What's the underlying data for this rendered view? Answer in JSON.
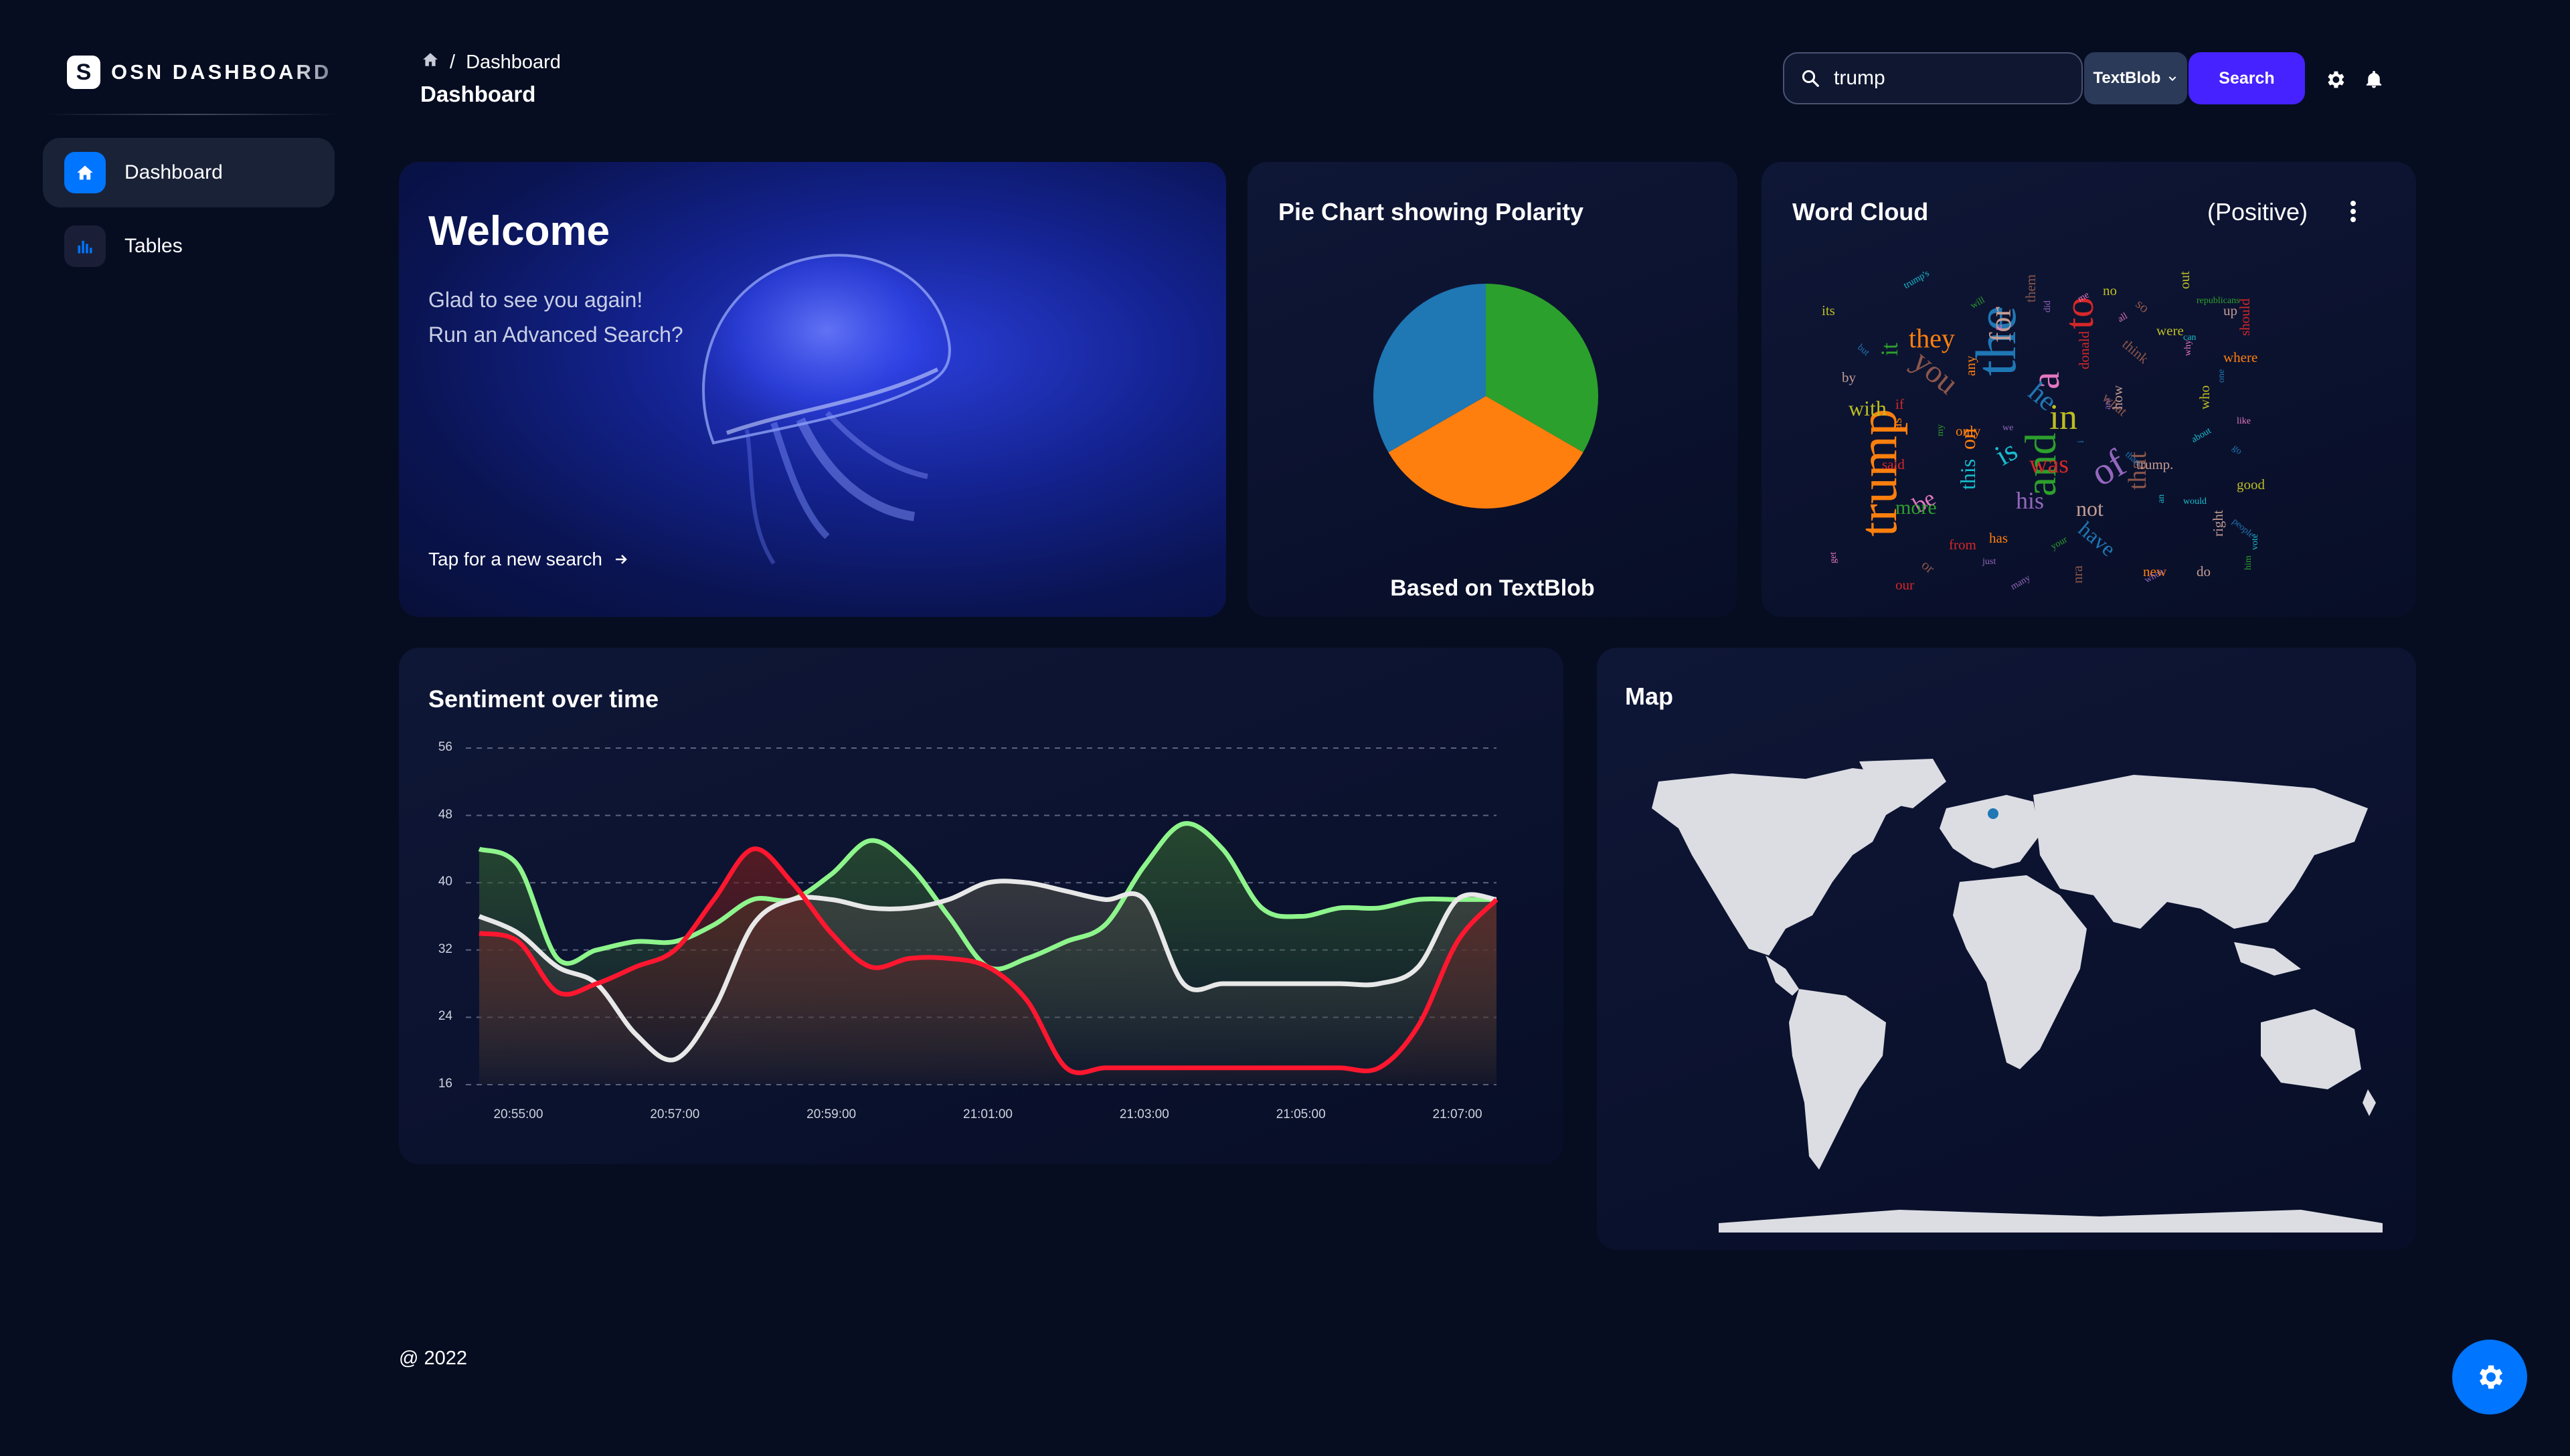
{
  "app": {
    "logo_mark": "S",
    "title": "OSN DASHBOARD"
  },
  "sidebar": {
    "items": [
      {
        "label": "Dashboard",
        "icon": "home-icon",
        "active": true
      },
      {
        "label": "Tables",
        "icon": "bar-chart-icon",
        "active": false
      }
    ]
  },
  "header": {
    "breadcrumb_current": "Dashboard",
    "title": "Dashboard",
    "search_value": "trump",
    "engine": "TextBlob",
    "search_label": "Search"
  },
  "welcome": {
    "title": "Welcome",
    "line1": "Glad to see you again!",
    "line2": "Run an Advanced Search?",
    "link": "Tap for a new search"
  },
  "pie": {
    "title": "Pie Chart showing Polarity",
    "caption": "Based on TextBlob"
  },
  "word_cloud": {
    "title": "Word Cloud",
    "subtitle": "(Positive)",
    "words": [
      "the",
      "trump",
      "and",
      "to",
      "of",
      "you",
      "a",
      "in",
      "is",
      "for",
      "he",
      "they",
      "it",
      "was",
      "his",
      "that",
      "be",
      "with",
      "this",
      "not",
      "have",
      "on",
      "more",
      "from",
      "are",
      "what",
      "at",
      "who",
      "about",
      "trump.",
      "i",
      "has",
      "your",
      "donald",
      "just",
      "think",
      "why",
      "were",
      "would",
      "right",
      "people",
      "new",
      "him",
      "our",
      "many",
      "nra",
      "like",
      "good",
      "vote",
      "by",
      "but",
      "as",
      "will",
      "if",
      "did",
      "so",
      "all",
      "out",
      "can",
      "up",
      "one",
      "where",
      "republicans",
      "should",
      "when",
      "or",
      "get",
      "its",
      "trump's",
      "how",
      "than",
      "only",
      "my",
      "said",
      "we",
      "them",
      "me",
      "no",
      "an",
      "do",
      "go",
      "any"
    ]
  },
  "trend": {
    "title": "Sentiment over time",
    "chart_data": {
      "type": "area",
      "x": [
        "20:54:30",
        "20:55:00",
        "20:55:30",
        "20:56:00",
        "20:56:30",
        "20:57:00",
        "20:57:30",
        "20:58:00",
        "20:58:30",
        "20:59:00",
        "20:59:30",
        "21:00:00",
        "21:00:30",
        "21:01:00",
        "21:01:30",
        "21:02:00",
        "21:02:30",
        "21:03:00",
        "21:03:30",
        "21:04:00",
        "21:04:30",
        "21:05:00",
        "21:05:30",
        "21:06:00",
        "21:06:30",
        "21:07:00",
        "21:07:30"
      ],
      "x_ticks": [
        "20:55:00",
        "20:57:00",
        "20:59:00",
        "21:01:00",
        "21:03:00",
        "21:05:00",
        "21:07:00"
      ],
      "ylim": [
        16,
        56
      ],
      "y_ticks": [
        16,
        24,
        32,
        40,
        48,
        56
      ],
      "series": [
        {
          "color": "#8ef58c",
          "fill_top": "#2f5a2f",
          "values": [
            44,
            42,
            31,
            32,
            33,
            33,
            35,
            38,
            38,
            41,
            45,
            42,
            36,
            30,
            31,
            33,
            35,
            42,
            47,
            44,
            37,
            36,
            37,
            37,
            38,
            38,
            38
          ]
        },
        {
          "color": "#e8e8e8",
          "fill_top": "#444444",
          "values": [
            36,
            34,
            30,
            28,
            22,
            19,
            25,
            35,
            38,
            38,
            37,
            37,
            38,
            40,
            40,
            39,
            38,
            38,
            28,
            28,
            28,
            28,
            28,
            28,
            30,
            38,
            38
          ]
        },
        {
          "color": "#ff1730",
          "fill_top": "#6b1e1e",
          "values": [
            34,
            33,
            27,
            28,
            30,
            32,
            38,
            44,
            40,
            34,
            30,
            31,
            31,
            30,
            26,
            18,
            18,
            18,
            18,
            18,
            18,
            18,
            18,
            18,
            23,
            33,
            38
          ]
        }
      ]
    }
  },
  "map": {
    "title": "Map"
  },
  "footer": {
    "text": "@ 2022"
  },
  "colors": {
    "accent": "#0075ff",
    "search_button": "#4522ff",
    "background": "#060d21"
  }
}
